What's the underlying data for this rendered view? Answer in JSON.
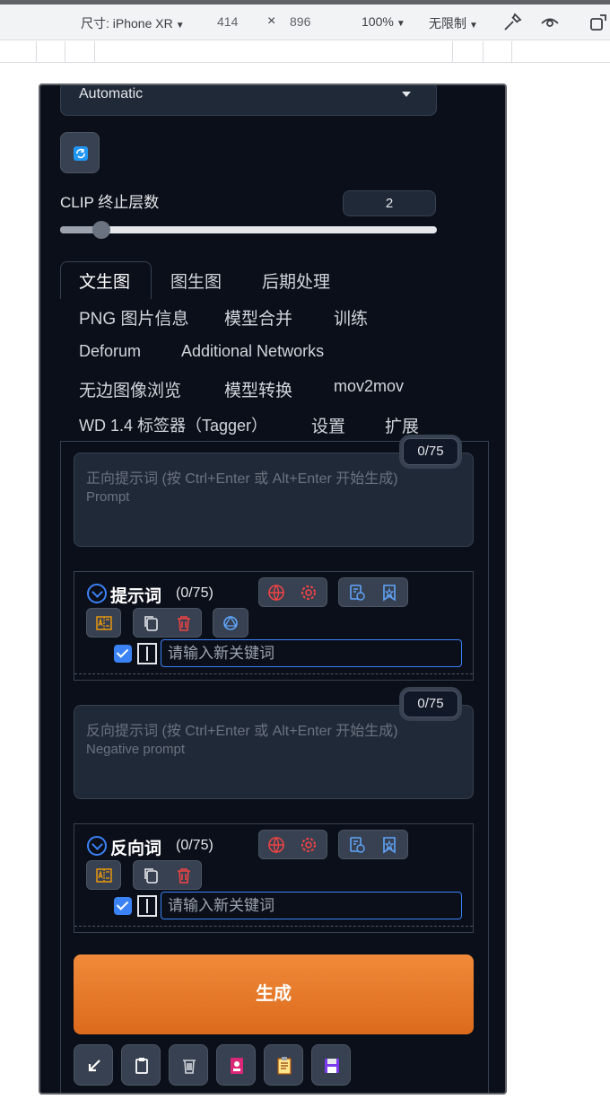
{
  "devtools": {
    "device_label": "尺寸: iPhone XR",
    "width": "414",
    "times": "×",
    "height": "896",
    "zoom": "100%",
    "throttle": "无限制"
  },
  "app": {
    "dropdown_value": "Automatic",
    "clip_label": "CLIP 终止层数",
    "clip_value": "2",
    "clip_slider_fraction": 0.11,
    "tabs_row1": [
      "文生图",
      "图生图",
      "后期处理"
    ],
    "tabs_row2": [
      "PNG 图片信息",
      "模型合并",
      "训练"
    ],
    "tabs_row3": [
      "Deforum",
      "Additional Networks"
    ],
    "tabs_row4": [
      "无边图像浏览",
      "模型转换",
      "mov2mov"
    ],
    "tabs_row5": [
      "WD 1.4 标签器（Tagger）",
      "设置",
      "扩展"
    ],
    "positive": {
      "counter": "0/75",
      "placeholder_line1": "正向提示词 (按 Ctrl+Enter 或 Alt+Enter 开始生成)",
      "placeholder_line2": "Prompt"
    },
    "positive_tags": {
      "title": "提示词",
      "count": "(0/75)",
      "input_placeholder": "请输入新关键词"
    },
    "negative": {
      "counter": "0/75",
      "placeholder_line1": "反向提示词 (按 Ctrl+Enter 或 Alt+Enter 开始生成)",
      "placeholder_line2": "Negative prompt"
    },
    "negative_tags": {
      "title": "反向词",
      "count": "(0/75)",
      "input_placeholder": "请输入新关键词"
    },
    "generate_label": "生成",
    "toolbar_icons": [
      "arrow-icon",
      "clipboard-icon",
      "trash-icon",
      "save-style-icon",
      "paste-icon",
      "floppy-icon"
    ],
    "colors": {
      "accent": "#e8772a",
      "bg": "#0b0f19",
      "link_blue": "#3b82f6"
    }
  }
}
